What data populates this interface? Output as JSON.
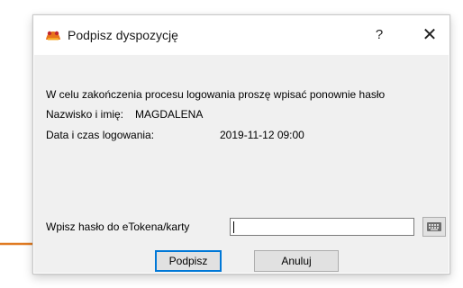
{
  "dialog": {
    "title": "Podpisz dyspozycję",
    "help_label": "?",
    "close_label": "✕",
    "icon": "app-logo-icon"
  },
  "content": {
    "message": "W celu zakończenia procesu logowania proszę wpisać ponownie hasło",
    "name_label": "Nazwisko i imię:",
    "name_value": "MAGDALENA",
    "datetime_label": "Data i czas logowania:",
    "datetime_value": "2019-11-12 09:00"
  },
  "password": {
    "label": "Wpisz hasło do eTokena/karty",
    "value": "",
    "keyboard_icon": "keyboard-icon"
  },
  "buttons": {
    "sign_label": "Podpisz",
    "cancel_label": "Anuluj"
  },
  "colors": {
    "annotation_arrow": "#e07b22",
    "default_button_border": "#0078d7",
    "client_background": "#f0f0f0"
  }
}
